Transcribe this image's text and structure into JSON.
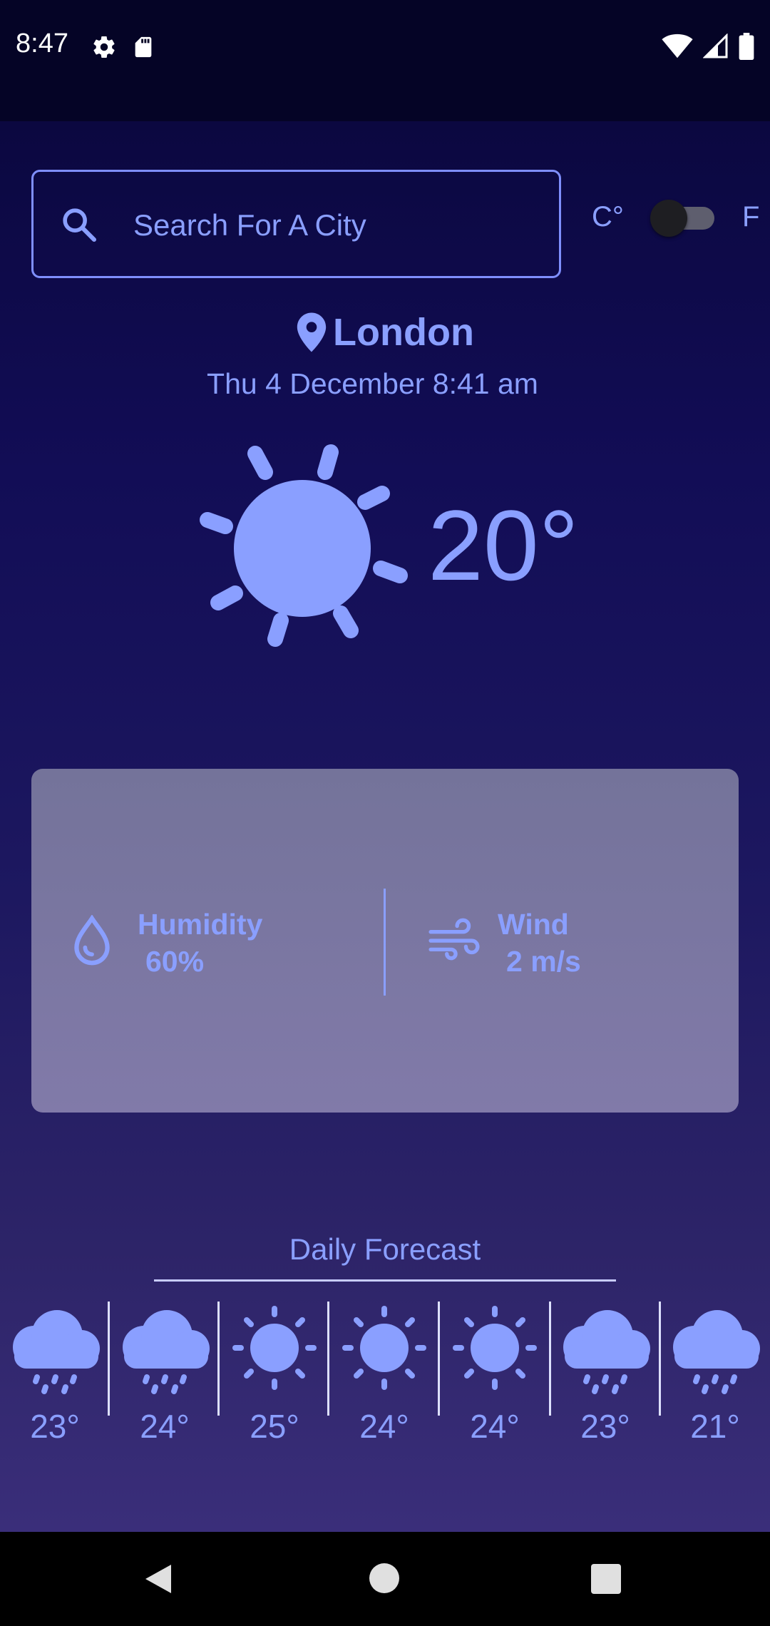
{
  "status_bar": {
    "time": "8:47",
    "left_icons": [
      "gear-icon",
      "sd-card-icon"
    ],
    "right_icons": [
      "wifi-icon",
      "signal-icon",
      "battery-icon"
    ]
  },
  "search": {
    "placeholder": "Search For A City",
    "value": ""
  },
  "units": {
    "celsius_label": "C°",
    "fahrenheit_label": "F",
    "fahrenheit_enabled": false
  },
  "location": {
    "city": "London",
    "datetime": "Thu 4 December 8:41 am"
  },
  "current": {
    "icon": "sun-icon",
    "temperature": "20°"
  },
  "details": {
    "humidity_label": "Humidity",
    "humidity_value": "60%",
    "wind_label": "Wind",
    "wind_value": "2 m/s"
  },
  "forecast": {
    "title": "Daily Forecast",
    "days": [
      {
        "icon": "rain-cloud-icon",
        "temp": "23°"
      },
      {
        "icon": "rain-cloud-icon",
        "temp": "24°"
      },
      {
        "icon": "sun-icon",
        "temp": "25°"
      },
      {
        "icon": "sun-icon",
        "temp": "24°"
      },
      {
        "icon": "sun-icon",
        "temp": "24°"
      },
      {
        "icon": "rain-cloud-icon",
        "temp": "23°"
      },
      {
        "icon": "rain-cloud-icon",
        "temp": "21°"
      }
    ]
  },
  "colors": {
    "accent": "#8a9fff",
    "background_top": "#0b0840",
    "background_bottom": "#3a2e7a",
    "card": "#7b77a2"
  },
  "nav_bar": {
    "icons": [
      "back-icon",
      "home-icon",
      "recent-apps-icon"
    ]
  }
}
